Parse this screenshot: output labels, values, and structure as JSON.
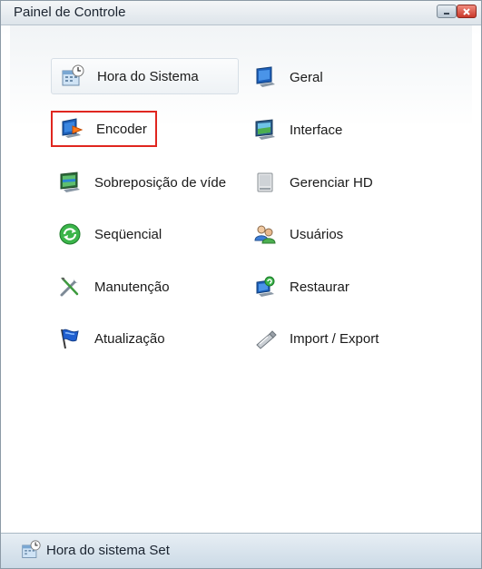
{
  "window": {
    "title": "Painel de Controle"
  },
  "items": {
    "hora_do_sistema": {
      "label": "Hora do Sistema",
      "icon": "calendar-clock-icon"
    },
    "geral": {
      "label": "Geral",
      "icon": "monitor-icon"
    },
    "encoder": {
      "label": "Encoder",
      "icon": "monitor-arrow-icon"
    },
    "interface": {
      "label": "Interface",
      "icon": "monitor-screen-icon"
    },
    "sobreposicao": {
      "label": "Sobreposição de víde",
      "icon": "monitor-overlay-icon"
    },
    "gerenciar_hd": {
      "label": "Gerenciar HD",
      "icon": "hard-disk-icon"
    },
    "sequencial": {
      "label": "Seqüencial",
      "icon": "green-cycle-icon"
    },
    "usuarios": {
      "label": "Usuários",
      "icon": "users-icon"
    },
    "manutencao": {
      "label": "Manutenção",
      "icon": "tools-icon"
    },
    "restaurar": {
      "label": "Restaurar",
      "icon": "restore-icon"
    },
    "atualizacao": {
      "label": "Atualização",
      "icon": "flag-icon"
    },
    "import_export": {
      "label": "Import / Export",
      "icon": "usb-stick-icon"
    }
  },
  "statusbar": {
    "text": "Hora do sistema Set",
    "icon": "calendar-clock-icon"
  },
  "colors": {
    "focus_border": "#e0261f",
    "title_bar": "#dde4ea",
    "status_bar": "#cbdae6"
  }
}
